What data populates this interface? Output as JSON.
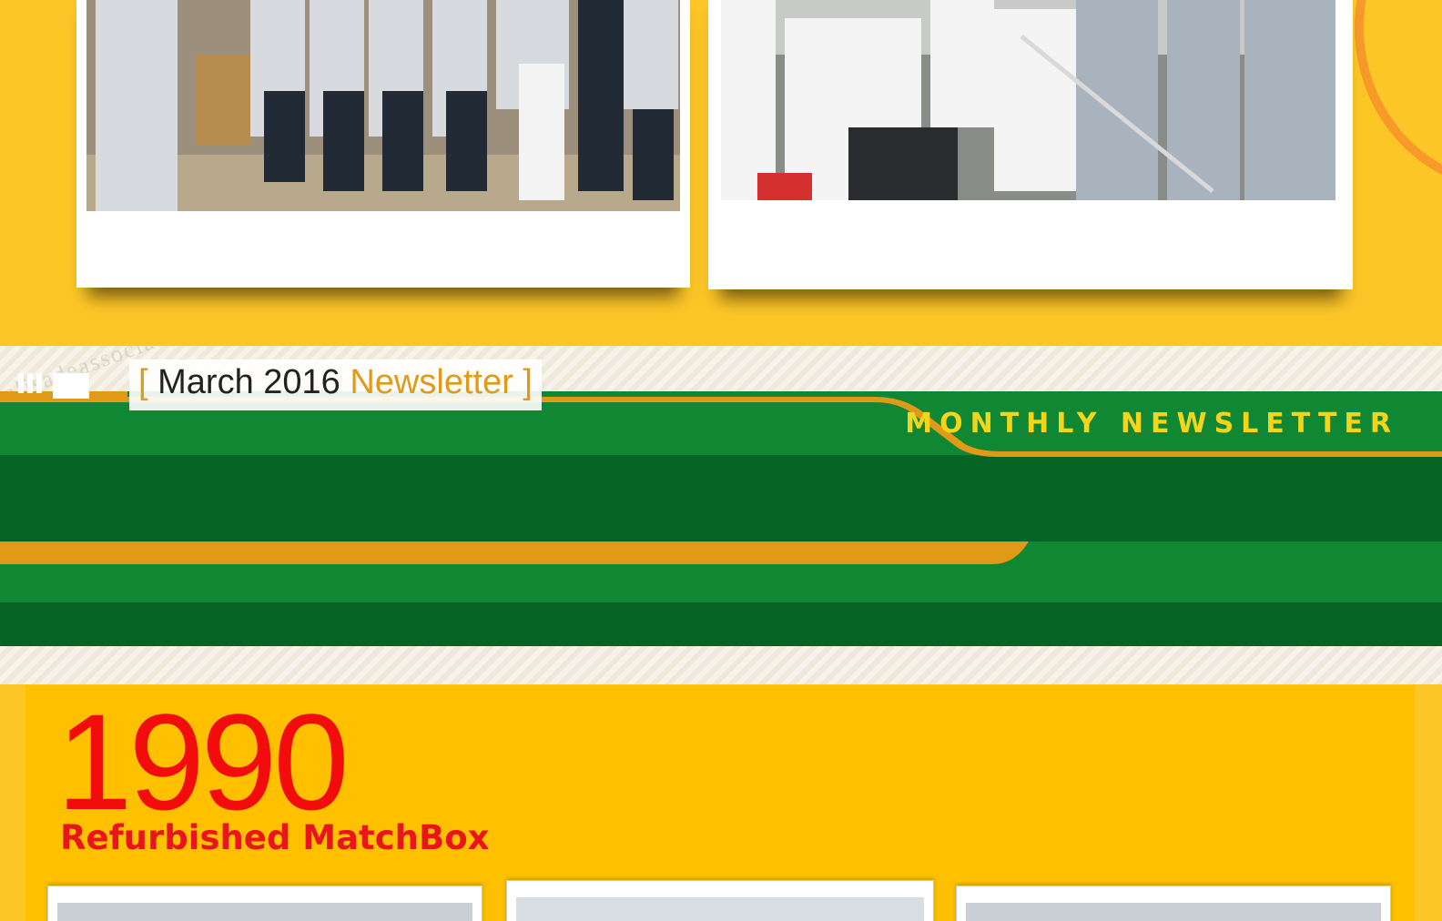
{
  "header": {
    "bracket_open": "[",
    "issue_date": "March 2016",
    "issue_word": "Newsletter",
    "bracket_close": "]",
    "banner_label": "MONTHLY NEWSLETTER"
  },
  "watermark_text": "alisadeassociates",
  "feature": {
    "year": "1990",
    "title": "Refurbished MatchBox"
  },
  "colors": {
    "page_yellow": "#fdc627",
    "banner_green": "#0f8733",
    "banner_dark_green": "#056323",
    "accent_orange": "#e09a17",
    "label_yellow": "#f4d51c",
    "year_red": "#f20c0c"
  }
}
